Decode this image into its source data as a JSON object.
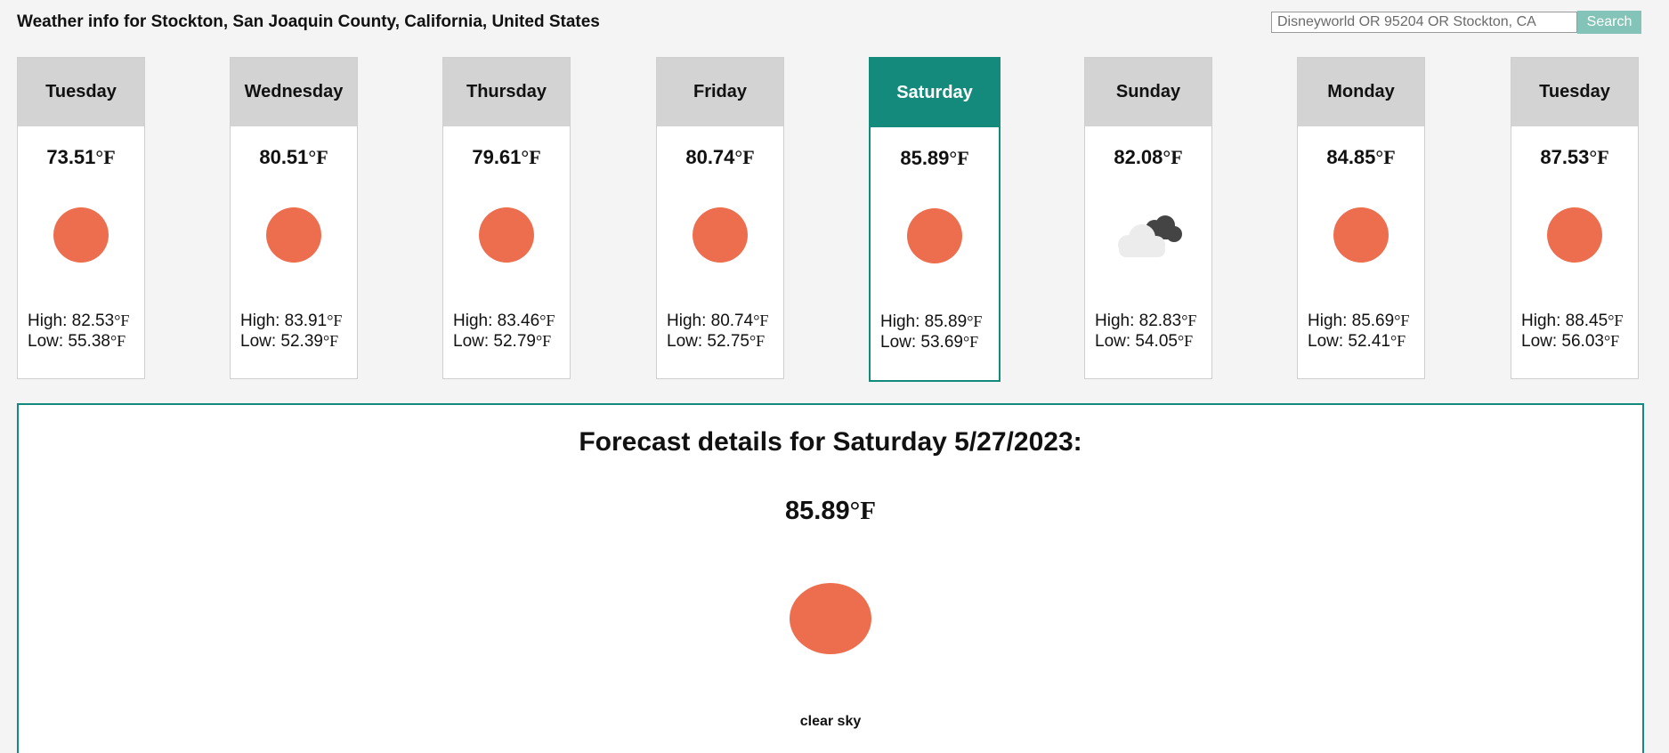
{
  "header": {
    "title": "Weather info for Stockton, San Joaquin County, California, United States"
  },
  "search": {
    "placeholder": "Disneyworld OR 95204 OR Stockton, CA",
    "button_label": "Search"
  },
  "unit_label": "°F",
  "days": [
    {
      "name": "Tuesday",
      "temp": "73.51",
      "high": "82.53",
      "low": "55.38",
      "icon": "sun-icon"
    },
    {
      "name": "Wednesday",
      "temp": "80.51",
      "high": "83.91",
      "low": "52.39",
      "icon": "sun-icon"
    },
    {
      "name": "Thursday",
      "temp": "79.61",
      "high": "83.46",
      "low": "52.79",
      "icon": "sun-icon"
    },
    {
      "name": "Friday",
      "temp": "80.74",
      "high": "80.74",
      "low": "52.75",
      "icon": "sun-icon"
    },
    {
      "name": "Saturday",
      "temp": "85.89",
      "high": "85.89",
      "low": "53.69",
      "icon": "sun-icon"
    },
    {
      "name": "Sunday",
      "temp": "82.08",
      "high": "82.83",
      "low": "54.05",
      "icon": "cloud-icon"
    },
    {
      "name": "Monday",
      "temp": "84.85",
      "high": "85.69",
      "low": "52.41",
      "icon": "sun-icon"
    },
    {
      "name": "Tuesday",
      "temp": "87.53",
      "high": "88.45",
      "low": "56.03",
      "icon": "sun-icon"
    }
  ],
  "labels": {
    "high": "High: ",
    "low": "Low: "
  },
  "details": {
    "title": "Forecast details for Saturday 5/27/2023:",
    "temp": "85.89",
    "description": "clear sky",
    "icon": "sun-icon"
  },
  "colors": {
    "accent": "#138a7c",
    "sun": "#ed6e4e",
    "search_button": "#84c4b8"
  }
}
